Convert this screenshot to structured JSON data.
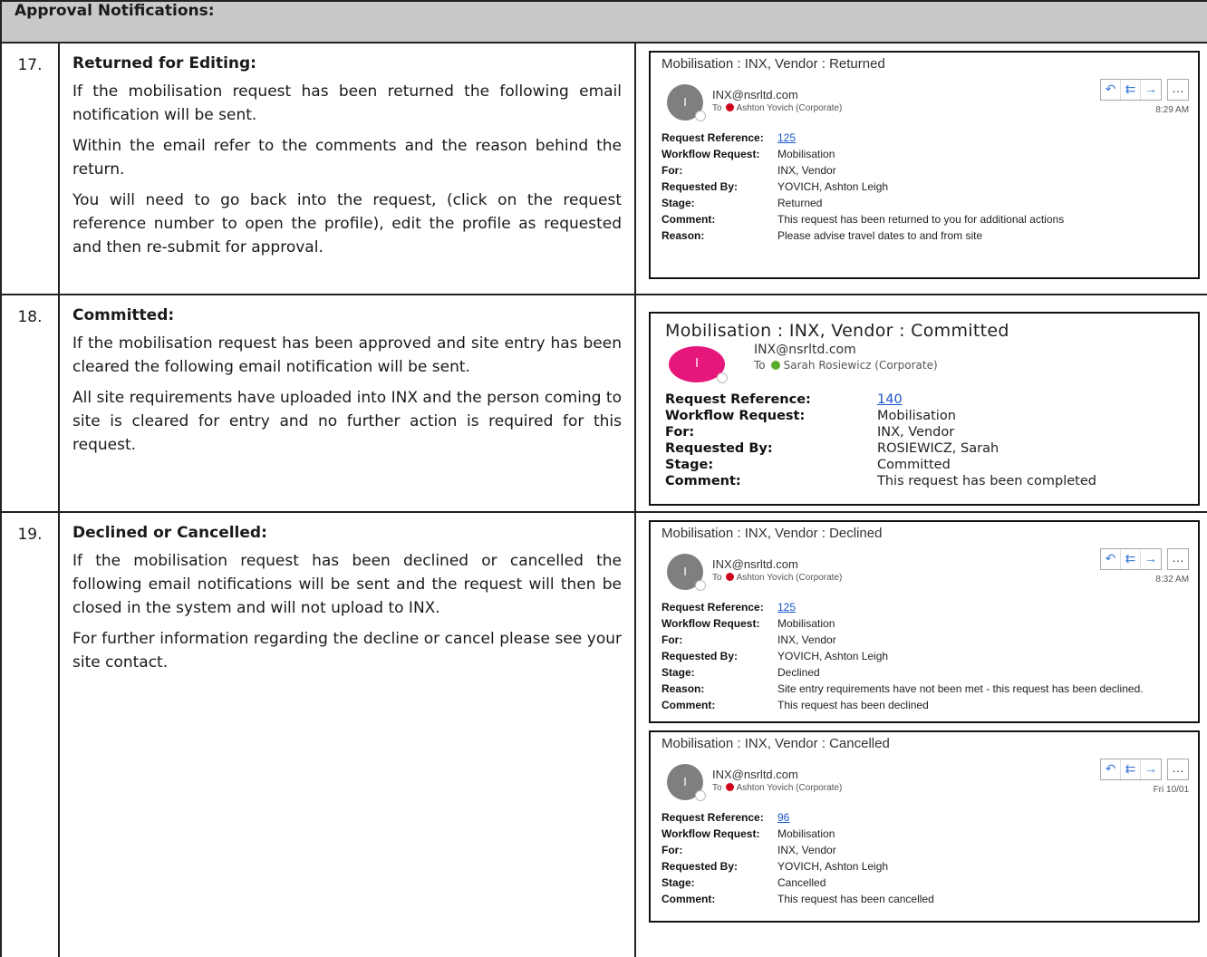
{
  "header": "Approval Notifications:",
  "steps": [
    {
      "num": "17.",
      "title": "Returned for Editing:",
      "paras": [
        "If the mobilisation request has been returned the following email notification will be sent.",
        "Within the email refer to the comments and the reason behind the return.",
        "You will need to go back into the request, (click on the request reference number to open the profile), edit the profile as requested and then re-submit for approval."
      ]
    },
    {
      "num": "18.",
      "title": "Committed:",
      "paras": [
        "If the mobilisation request has been approved and site entry has been cleared the following email notification will be sent.",
        "All site requirements have uploaded into INX and the person coming to site is cleared for entry and no further action is required for this request."
      ]
    },
    {
      "num": "19.",
      "title": "Declined or Cancelled:",
      "paras": [
        "If the mobilisation request has been declined or cancelled the following email notifications will be sent and the request will then be closed in the system and will not upload to INX.",
        "For further information regarding the decline or cancel please see your site contact."
      ]
    }
  ],
  "icons": {
    "reply": "reply-icon",
    "reply_all": "reply-all-icon",
    "forward": "forward-icon",
    "more": "more-icon"
  },
  "emails": {
    "returned": {
      "subject": "Mobilisation : INX, Vendor : Returned",
      "avatar": "I",
      "from": "INX@nsrltd.com",
      "to_prefix": "To",
      "to": "Ashton Yovich (Corporate)",
      "time": "8:29 AM",
      "fields": [
        {
          "label": "Request Reference:",
          "value": "125",
          "link": true
        },
        {
          "label": "Workflow Request:",
          "value": "Mobilisation"
        },
        {
          "label": "For:",
          "value": "INX, Vendor"
        },
        {
          "label": "Requested By:",
          "value": "YOVICH, Ashton Leigh"
        },
        {
          "label": "Stage:",
          "value": "Returned"
        },
        {
          "label": "Comment:",
          "value": "This request has been returned to you for additional actions"
        },
        {
          "label": "Reason:",
          "value": "Please advise travel dates to and from site"
        }
      ]
    },
    "committed": {
      "subject": "Mobilisation : INX, Vendor : Committed",
      "avatar": "I",
      "from": "INX@nsrltd.com",
      "to_prefix": "To",
      "to": "Sarah Rosiewicz (Corporate)",
      "fields": [
        {
          "label": "Request Reference:",
          "value": "140",
          "link": true
        },
        {
          "label": "Workflow Request:",
          "value": "Mobilisation"
        },
        {
          "label": "For:",
          "value": "INX, Vendor"
        },
        {
          "label": "Requested By:",
          "value": "ROSIEWICZ, Sarah"
        },
        {
          "label": "Stage:",
          "value": "Committed"
        },
        {
          "label": "Comment:",
          "value": "This request has been completed"
        }
      ]
    },
    "declined": {
      "subject": "Mobilisation : INX, Vendor : Declined",
      "avatar": "I",
      "from": "INX@nsrltd.com",
      "to_prefix": "To",
      "to": "Ashton Yovich (Corporate)",
      "time": "8:32 AM",
      "fields": [
        {
          "label": "Request Reference:",
          "value": "125",
          "link": true
        },
        {
          "label": "Workflow Request:",
          "value": "Mobilisation"
        },
        {
          "label": "For:",
          "value": "INX, Vendor"
        },
        {
          "label": "Requested By:",
          "value": "YOVICH, Ashton Leigh"
        },
        {
          "label": "Stage:",
          "value": "Declined"
        },
        {
          "label": "Reason:",
          "value": "Site entry requirements have not been met - this request has been declined."
        },
        {
          "label": "Comment:",
          "value": "This request has been declined"
        }
      ]
    },
    "cancelled": {
      "subject": "Mobilisation : INX, Vendor : Cancelled",
      "avatar": "I",
      "from": "INX@nsrltd.com",
      "to_prefix": "To",
      "to": "Ashton Yovich (Corporate)",
      "time": "Fri 10/01",
      "fields": [
        {
          "label": "Request Reference:",
          "value": "96",
          "link": true
        },
        {
          "label": "Workflow Request:",
          "value": "Mobilisation"
        },
        {
          "label": "For:",
          "value": "INX, Vendor"
        },
        {
          "label": "Requested By:",
          "value": "YOVICH, Ashton Leigh"
        },
        {
          "label": "Stage:",
          "value": "Cancelled"
        },
        {
          "label": "Comment:",
          "value": "This request has been cancelled"
        }
      ]
    }
  }
}
